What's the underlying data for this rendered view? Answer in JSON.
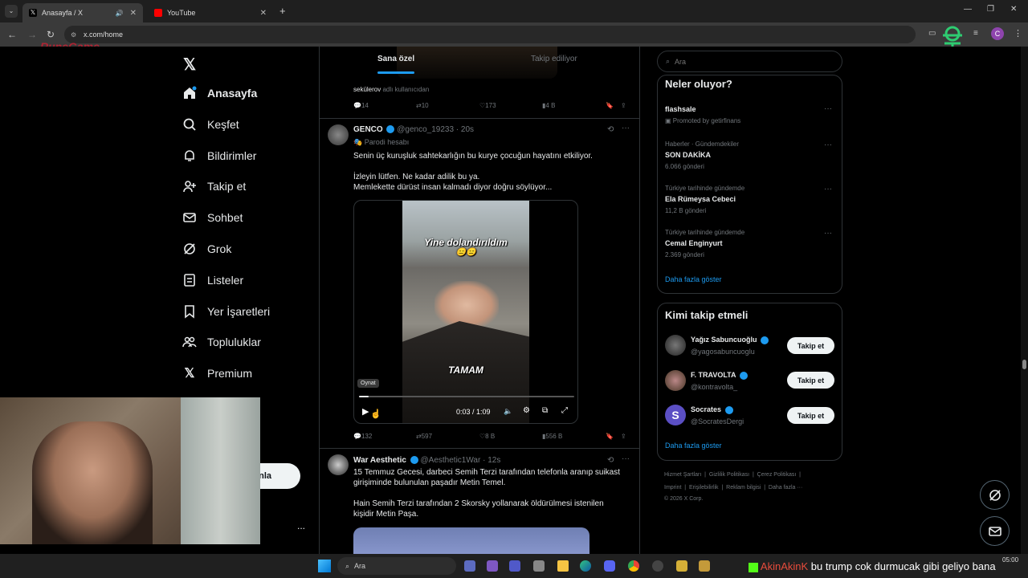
{
  "browser": {
    "tabs": [
      {
        "label": "Anasayfa / X",
        "active": true
      },
      {
        "label": "YouTube",
        "active": false
      }
    ],
    "url": "x.com/home",
    "overlay_logo": "RuneGame"
  },
  "sidebar": {
    "items": [
      {
        "label": "Anasayfa",
        "icon": "home-icon"
      },
      {
        "label": "Keşfet",
        "icon": "search-icon"
      },
      {
        "label": "Bildirimler",
        "icon": "bell-icon"
      },
      {
        "label": "Takip et",
        "icon": "add-user-icon"
      },
      {
        "label": "Sohbet",
        "icon": "mail-icon"
      },
      {
        "label": "Grok",
        "icon": "grok-icon"
      },
      {
        "label": "Listeler",
        "icon": "list-icon"
      },
      {
        "label": "Yer İşaretleri",
        "icon": "bookmark-icon"
      },
      {
        "label": "Topluluklar",
        "icon": "communities-icon"
      },
      {
        "label": "Premium",
        "icon": "x-logo-icon"
      }
    ],
    "post_button_partial": "nla",
    "more": "..."
  },
  "timeline": {
    "tabs": [
      "Sana özel",
      "Takip ediliyor"
    ],
    "prev_tweet": {
      "attribution_user": "sekülerov",
      "attribution_rest": "adlı kullanıcıdan",
      "stats": {
        "replies": "14",
        "reposts": "10",
        "likes": "173",
        "views": "4 B"
      }
    },
    "tweet1": {
      "name": "GENCO",
      "handle": "@genco_19233",
      "time": "· 20s",
      "parody": "Parodi hesabı",
      "line1": "Senin üç kuruşluk sahtekarlığın bu kurye çocuğun hayatını etkiliyor.",
      "line2": "İzleyin lütfen. Ne kadar adilik bu ya.",
      "line3": "Memlekette dürüst insan kalmadı diyor doğru söylüyor...",
      "video_caption_top": "Yine dolandırıldım",
      "video_caption_emoji": "😑😑",
      "video_caption_bottom": "TAMAM",
      "tooltip": "Oynat",
      "time_display": "0:03 / 1:09",
      "progress": 0.044,
      "stats": {
        "replies": "132",
        "reposts": "597",
        "likes": "8 B",
        "views": "556 B"
      }
    },
    "tweet2": {
      "name": "War Aesthetic",
      "handle": "@Aesthetic1War",
      "time": "· 12s",
      "line1": "15 Temmuz Gecesi, darbeci Semih Terzi tarafından telefonla aranıp suikast",
      "line2": "girişiminde bulunulan paşadır Metin Temel.",
      "line3": "Hain Semih Terzi tarafından 2 Skorsky yollanarak öldürülmesi istenilen",
      "line4": "kişidir Metin Paşa."
    }
  },
  "right": {
    "search_placeholder": "Ara",
    "trends_title": "Neler oluyor?",
    "trends": [
      {
        "meta": "",
        "title": "flashsale",
        "sub": "Promoted by getirfinans"
      },
      {
        "meta": "Haberler · Gündemdekiler",
        "title": "SON DAKİKA",
        "sub": "6.066 gönderi"
      },
      {
        "meta": "Türkiye tarihinde gündemde",
        "title": "Ela Rümeysa Cebeci",
        "sub": "11,2 B gönderi"
      },
      {
        "meta": "Türkiye tarihinde gündemde",
        "title": "Cemal Enginyurt",
        "sub": "2.369 gönderi"
      }
    ],
    "show_more": "Daha fazla göster",
    "who_title": "Kimi takip etmeli",
    "suggestions": [
      {
        "name": "Yağız Sabuncuoğlu",
        "handle": "@yagosabuncuoglu",
        "button": "Takip et"
      },
      {
        "name": "F. TRAVOLTA",
        "handle": "@kontravolta_",
        "button": "Takip et"
      },
      {
        "name": "Socrates",
        "handle": "@SocratesDergi",
        "button": "Takip et"
      }
    ],
    "show_more2": "Daha fazla göster",
    "footer1": "Hizmet Şartları  |  Gizlilik Politikası  |  Çerez Politikası  |",
    "footer2": "Imprint  |  Erişilebilirlik  |  Reklam bilgisi  |  Daha fazla ···",
    "footer3": "© 2026 X Corp."
  },
  "taskbar": {
    "search": "Ara",
    "ticker_user": "AkinAkinK",
    "ticker_text": "bu trump cok durmucak gibi geliyo bana",
    "clock": "05:00"
  },
  "colors": {
    "accent": "#1d9bf0",
    "bg": "#000000",
    "border": "#2f3336"
  }
}
